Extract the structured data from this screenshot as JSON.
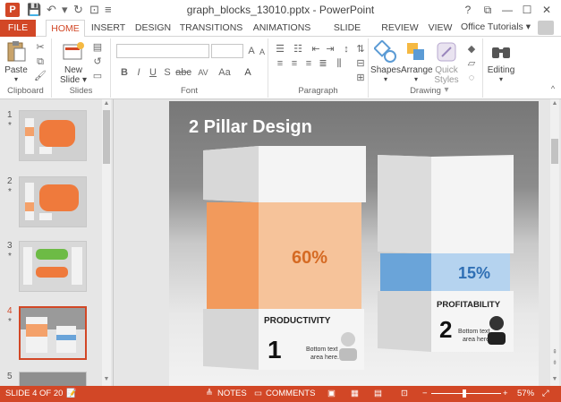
{
  "window": {
    "title": "graph_blocks_13010.pptx - PowerPoint",
    "help": "?",
    "restore_ribbon": "⧉",
    "minimize": "—",
    "maximize": "☐",
    "close": "✕"
  },
  "tabs": [
    {
      "label": "FILE"
    },
    {
      "label": "HOME"
    },
    {
      "label": "INSERT"
    },
    {
      "label": "DESIGN"
    },
    {
      "label": "TRANSITIONS"
    },
    {
      "label": "ANIMATIONS"
    },
    {
      "label": "SLIDE SHOW"
    },
    {
      "label": "REVIEW"
    },
    {
      "label": "VIEW"
    }
  ],
  "account": {
    "label": "Office Tutorials ▾"
  },
  "ribbon": {
    "clipboard": {
      "label": "Clipboard",
      "paste": "Paste"
    },
    "slides": {
      "label": "Slides",
      "new_slide": "New",
      "new_slide2": "Slide ▾"
    },
    "font": {
      "label": "Font",
      "bold": "B",
      "italic": "I",
      "underline": "U",
      "strike": "S",
      "abc": "abc",
      "av": "AV",
      "aa": "Aa",
      "a": "A",
      "grow": "A",
      "shrink": "A"
    },
    "paragraph": {
      "label": "Paragraph"
    },
    "drawing": {
      "label": "Drawing",
      "shapes": "Shapes",
      "arrange": "Arrange",
      "quick_styles": "Quick",
      "quick_styles2": "Styles ▾"
    },
    "editing": {
      "label": "Editing"
    }
  },
  "thumbnails": [
    {
      "num": "1",
      "star": "*"
    },
    {
      "num": "2",
      "star": "*"
    },
    {
      "num": "3",
      "star": "*"
    },
    {
      "num": "4",
      "star": "*"
    },
    {
      "num": "5",
      "star": ""
    }
  ],
  "slide": {
    "title": "2 Pillar Design",
    "pillar1": {
      "percent": "60%",
      "heading": "PRODUCTIVITY",
      "number": "1",
      "text1": "Bottom text",
      "text2": "area here."
    },
    "pillar2": {
      "percent": "15%",
      "heading": "PROFITABILITY",
      "number": "2",
      "text1": "Bottom text",
      "text2": "area here."
    }
  },
  "status": {
    "slide_info": "SLIDE 4 OF 20",
    "notes": "NOTES",
    "comments": "COMMENTS",
    "zoom": "57%",
    "zoom_minus": "−",
    "zoom_plus": "+"
  },
  "colors": {
    "accent": "#d24726",
    "orange": "#f4a16a",
    "blue": "#6aa4d9",
    "percent_orange": "#d56a23",
    "percent_blue": "#2f6fb4"
  }
}
